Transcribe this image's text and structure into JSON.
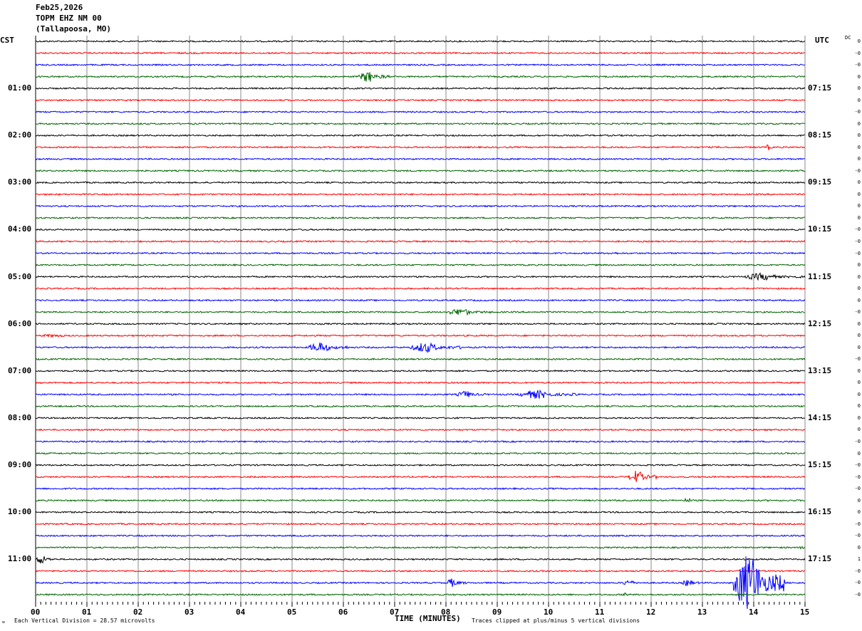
{
  "header": {
    "date": "Feb25,2026",
    "station": "TOPM EHZ NM 00",
    "location": "(Tallapoosa, MO)"
  },
  "left_zone": "CST",
  "right_zone": "UTC",
  "dc_label": "DC",
  "footer": {
    "xlabel": "TIME (MINUTES)",
    "scale_note": "Each Vertical Division =   28.57 microvolts",
    "clip_note": "Traces clipped at plus/minus 5 vertical divisions"
  },
  "chart_data": {
    "type": "line",
    "subtype": "helicorder",
    "x_ticks": [
      "00",
      "01",
      "02",
      "03",
      "04",
      "05",
      "06",
      "07",
      "08",
      "09",
      "10",
      "11",
      "12",
      "13",
      "14",
      "15"
    ],
    "xlim": [
      0,
      15
    ],
    "grid": "vertical lines each minute",
    "trace_colors": [
      "#000000",
      "#ff0000",
      "#0000ff",
      "#006400"
    ],
    "left_hour_labels": [
      "01:00",
      "02:00",
      "03:00",
      "04:00",
      "05:00",
      "06:00",
      "07:00",
      "08:00",
      "09:00",
      "10:00",
      "11:00"
    ],
    "right_hour_labels": [
      "07:15",
      "08:15",
      "09:15",
      "10:15",
      "11:15",
      "12:15",
      "13:15",
      "14:15",
      "15:15",
      "16:15",
      "17:15"
    ],
    "rows": 48,
    "dc_values": [
      "0",
      "-0",
      "-0",
      "0",
      "0",
      "0",
      "-0",
      "0",
      "0",
      "0",
      "0",
      "-0",
      "0",
      "0",
      "0",
      "0",
      "-0",
      "-0",
      "-0",
      "0",
      "0",
      "0",
      "0",
      "-0",
      "0",
      "0",
      "0",
      "-0",
      "0",
      "0",
      "0",
      "0",
      "0",
      "0",
      "-0",
      "0",
      "-0",
      "-0",
      "-0",
      "0",
      "0",
      "-0",
      "-0",
      "0",
      "1",
      "-0",
      "-0",
      "-0"
    ],
    "events": [
      {
        "row": 3,
        "start_min": 6.3,
        "end_min": 6.9,
        "amplitude": 8
      },
      {
        "row": 9,
        "start_min": 14.25,
        "end_min": 14.35,
        "amplitude": 5
      },
      {
        "row": 18,
        "start_min": 11.1,
        "end_min": 11.6,
        "amplitude": 2
      },
      {
        "row": 20,
        "start_min": 13.8,
        "end_min": 14.95,
        "amplitude": 5
      },
      {
        "row": 23,
        "start_min": 8.0,
        "end_min": 8.9,
        "amplitude": 5
      },
      {
        "row": 25,
        "start_min": 0.0,
        "end_min": 1.1,
        "amplitude": 2
      },
      {
        "row": 26,
        "start_min": 5.3,
        "end_min": 6.1,
        "amplitude": 7
      },
      {
        "row": 26,
        "start_min": 7.3,
        "end_min": 8.3,
        "amplitude": 7
      },
      {
        "row": 30,
        "start_min": 8.2,
        "end_min": 8.8,
        "amplitude": 5
      },
      {
        "row": 30,
        "start_min": 9.4,
        "end_min": 10.6,
        "amplitude": 6
      },
      {
        "row": 37,
        "start_min": 11.55,
        "end_min": 12.1,
        "amplitude": 9
      },
      {
        "row": 39,
        "start_min": 12.6,
        "end_min": 12.95,
        "amplitude": 3
      },
      {
        "row": 43,
        "start_min": 14.9,
        "end_min": 15.0,
        "amplitude": 5
      },
      {
        "row": 44,
        "start_min": 0.0,
        "end_min": 0.35,
        "amplitude": 7
      },
      {
        "row": 46,
        "start_min": 8.0,
        "end_min": 8.4,
        "amplitude": 6
      },
      {
        "row": 46,
        "start_min": 11.4,
        "end_min": 11.9,
        "amplitude": 4
      },
      {
        "row": 46,
        "start_min": 12.6,
        "end_min": 13.0,
        "amplitude": 5
      },
      {
        "row": 46,
        "start_min": 13.6,
        "end_min": 14.6,
        "amplitude": 40
      },
      {
        "row": 47,
        "start_min": 11.45,
        "end_min": 11.6,
        "amplitude": 4
      }
    ]
  }
}
